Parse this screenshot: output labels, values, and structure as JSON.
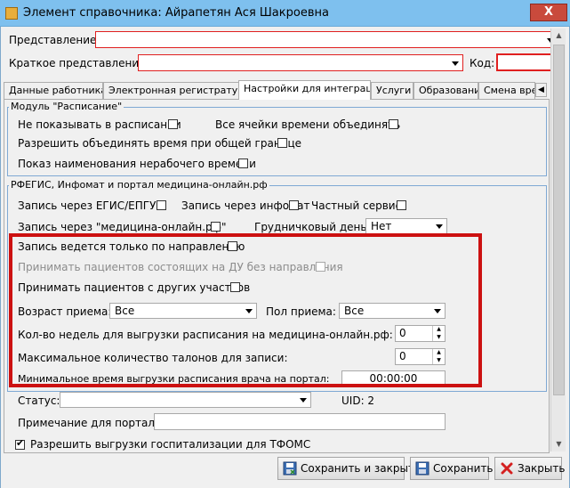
{
  "window": {
    "title": "Элемент справочника: Айрапетян Ася Шакроевна",
    "close_glyph": "X"
  },
  "header": {
    "representation_label": "Представление:",
    "representation_value": "",
    "short_representation_label": "Краткое представление:",
    "short_representation_value": "",
    "code_label": "Код:",
    "code_value": ""
  },
  "tabs": [
    {
      "label": "Данные работника"
    },
    {
      "label": "Электронная регистратура"
    },
    {
      "label": "Настройки для интеграции"
    },
    {
      "label": "Услуги"
    },
    {
      "label": "Образование"
    },
    {
      "label": "Смена врем"
    }
  ],
  "schedule_module": {
    "title": "Модуль \"Расписание\"",
    "dont_show_label": "Не показывать в расписании",
    "merge_all_label": "Все ячейки времени объединять",
    "merge_border_label": "Разрешить объединять время при общей границе",
    "show_nonworking_label": "Показ наименования нерабочего времени"
  },
  "integration": {
    "title": "РФЕГИС, Инфомат и портал медицина-онлайн.рф",
    "egis_label": "Запись через ЕГИС/ЕПГУ",
    "infomat_label": "Запись через инфомат",
    "private_label": "Частный сервис",
    "medonline_label": "Запись через \"медицина-онлайн.рф\"",
    "infant_day_label": "Грудничковый день:",
    "infant_day_value": "Нет",
    "referral_only_label": "Запись ведется только по направлению",
    "du_patients_label": "Принимать пациентов состоящих на ДУ без направления",
    "other_areas_label": "Принимать пациентов с других участков",
    "age_label": "Возраст приема:",
    "age_value": "Все",
    "gender_label": "Пол приема:",
    "gender_value": "Все",
    "weeks_label": "Кол-во недель для выгрузки расписания на медицина-онлайн.рф:",
    "weeks_value": "0",
    "max_tickets_label": "Максимальное количество талонов для записи:",
    "max_tickets_value": "0",
    "min_time_label": "Минимальное время выгрузки расписания врача на портал:",
    "min_time_value": "00:00:00"
  },
  "footer_fields": {
    "status_label": "Статус:",
    "status_value": "",
    "uid_label": "UID: 2",
    "portal_note_label": "Примечание для портала:",
    "portal_note_value": "",
    "tfoms_label": "Разрешить выгрузки госпитализации для ТФОМС"
  },
  "buttons": {
    "save_close": "Сохранить и закрыть",
    "save": "Сохранить",
    "close": "Закрыть"
  },
  "colors": {
    "titlebar": "#7ec0ee",
    "highlight_box": "#cc1111",
    "required_border": "#e02020",
    "groupbox_border": "#7fa9d4"
  }
}
